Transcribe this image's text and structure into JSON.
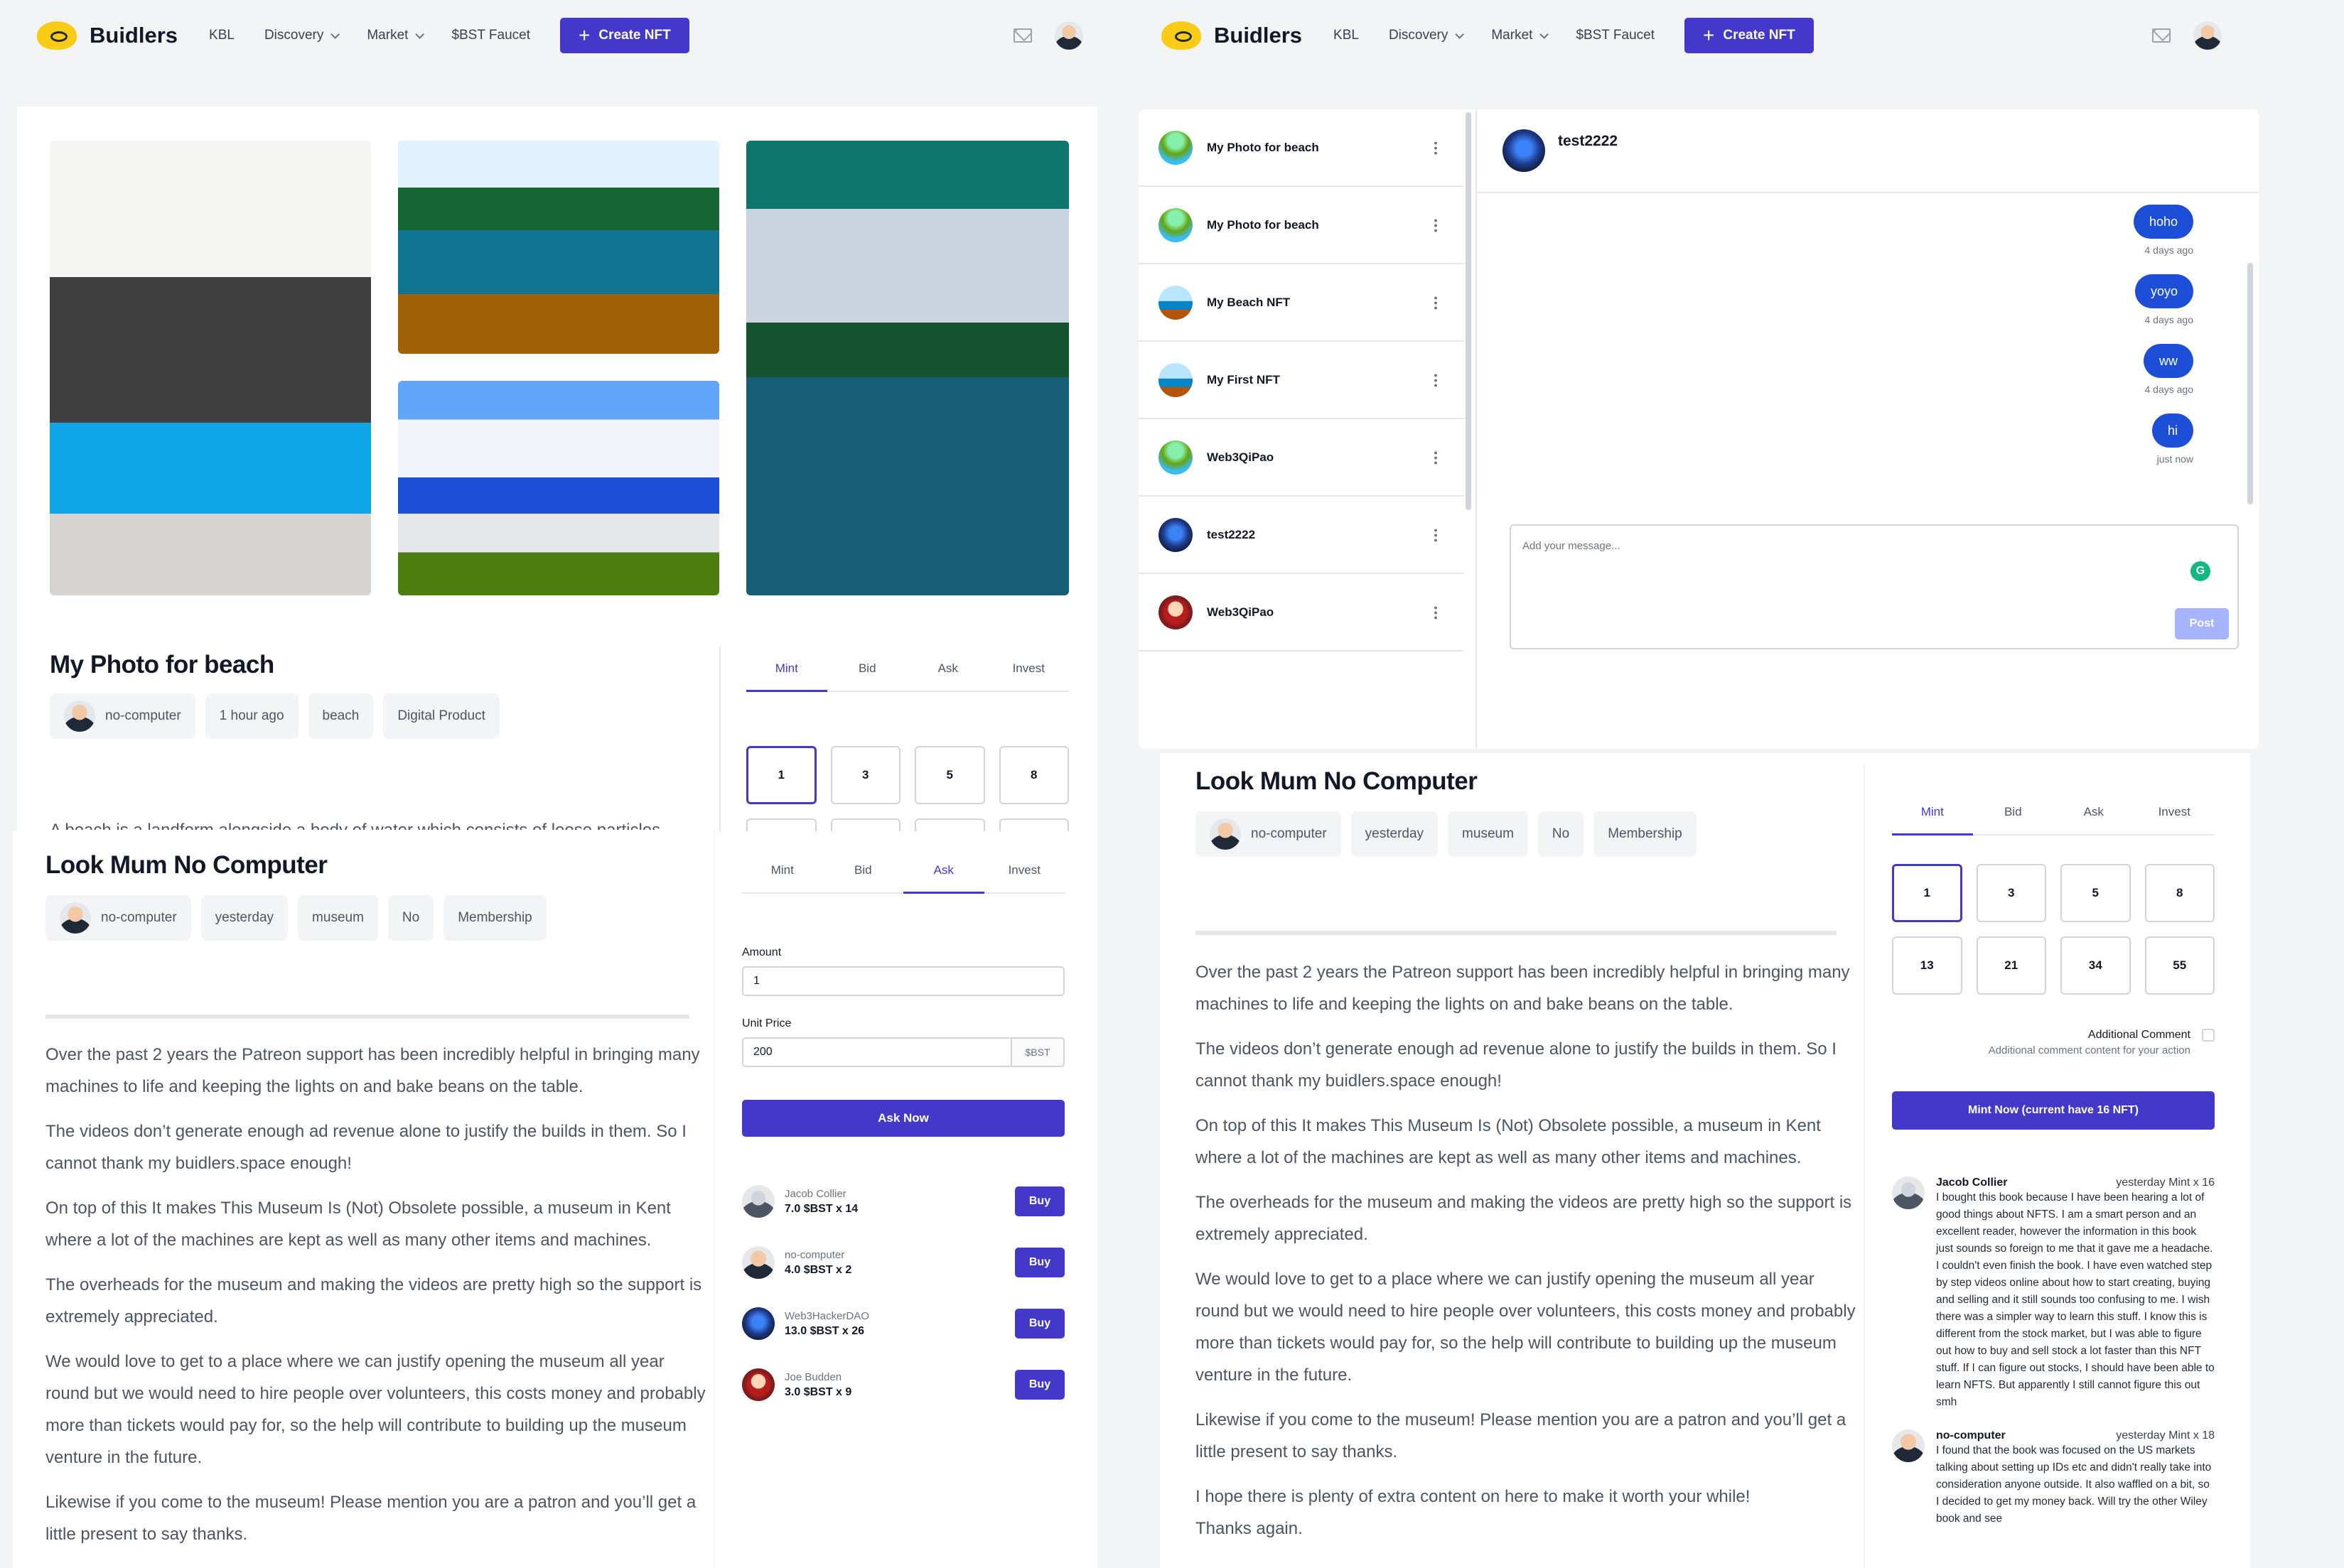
{
  "nav": {
    "brand": "Buidlers",
    "links": [
      "KBL",
      "Discovery",
      "Market",
      "$BST Faucet"
    ],
    "create_label": "Create NFT"
  },
  "beach": {
    "title": "My Photo for beach",
    "tags": [
      "no-computer",
      "1 hour ago",
      "beach",
      "Digital Product"
    ],
    "tabs": [
      "Mint",
      "Bid",
      "Ask",
      "Invest"
    ],
    "quantities": [
      "1",
      "3",
      "5",
      "8"
    ],
    "desc_partial": "A beach is a landform alongside a body of water which consists of loose particles"
  },
  "museum": {
    "title": "Look Mum No Computer",
    "tags": [
      "no-computer",
      "yesterday",
      "museum",
      "No",
      "Membership"
    ],
    "paragraphs": [
      "Over the past 2 years the Patreon support has been incredibly helpful in bringing many machines to life and keeping the lights on and bake beans on the table.",
      "The videos don’t generate enough ad revenue alone to justify the builds in them. So I cannot thank my buidlers.space enough!",
      "On top of this It makes This Museum Is (Not) Obsolete possible, a museum in Kent where a lot of the machines are kept as well as many other items and machines.",
      "The overheads for the museum and making the videos are pretty high so the support is extremely appreciated.",
      "We would love to get to a place where we can justify opening the museum all year round but we would need to hire people over volunteers, this costs money and probably more than tickets would pay for, so the help will contribute to building up the museum venture in the future.",
      "Likewise if you come to the museum! Please mention you are a patron and you’ll get a little present to say thanks.",
      "I hope there is plenty of extra content on here to make it worth your while! Thanks again."
    ]
  },
  "ask": {
    "tabs": [
      "Mint",
      "Bid",
      "Ask",
      "Invest"
    ],
    "amount_label": "Amount",
    "amount_value": "1",
    "price_label": "Unit Price",
    "price_value": "200",
    "price_unit": "$BST",
    "submit": "Ask Now",
    "bids": [
      {
        "name": "Jacob Collier",
        "value": "7.0 $BST x 14",
        "action": "Buy"
      },
      {
        "name": "no-computer",
        "value": "4.0 $BST x 2",
        "action": "Buy"
      },
      {
        "name": "Web3HackerDAO",
        "value": "13.0 $BST x 26",
        "action": "Buy"
      },
      {
        "name": "Joe Budden",
        "value": "3.0 $BST x 9",
        "action": "Buy"
      }
    ]
  },
  "chat": {
    "conversations": [
      "My Photo for beach",
      "My Photo for beach",
      "My Beach NFT",
      "My First NFT",
      "Web3QiPao",
      "test2222",
      "Web3QiPao"
    ],
    "active_user": "test2222",
    "messages": [
      {
        "text": "hoho",
        "time": "4 days ago"
      },
      {
        "text": "yoyo",
        "time": "4 days ago"
      },
      {
        "text": "ww",
        "time": "4 days ago"
      },
      {
        "text": "hi",
        "time": "just now"
      }
    ],
    "placeholder": "Add your message...",
    "post": "Post"
  },
  "mint": {
    "tabs": [
      "Mint",
      "Bid",
      "Ask",
      "Invest"
    ],
    "quantities": [
      "1",
      "3",
      "5",
      "8",
      "13",
      "21",
      "34",
      "55"
    ],
    "comment_label": "Additional Comment",
    "comment_hint": "Additional comment content for your action",
    "submit": "Mint Now (current have 16 NFT)",
    "comments": [
      {
        "name": "Jacob Collier",
        "meta": "yesterday Mint x 16",
        "text": "I bought this book because I have been hearing a lot of good things about NFTS. I am a smart person and an excellent reader, however the information in this book just sounds so foreign to me that it gave me a headache. I couldn't even finish the book. I have even watched step by step videos online about how to start creating, buying and selling and it still sounds too confusing to me. I wish there was a simpler way to learn this stuff. I know this is different from the stock market, but I was able to figure out how to buy and sell stock a lot faster than this NFT stuff. If I can figure out stocks, I should have been able to learn NFTS. But apparently I still cannot figure this out smh"
      },
      {
        "name": "no-computer",
        "meta": "yesterday Mint x 18",
        "text": "I found that the book was focused on the US markets talking about setting up IDs etc and didn't really take into consideration anyone outside. It also waffled on a bit, so I decided to get my money back. Will try the other Wiley book and see"
      }
    ]
  },
  "colors": {
    "accent": "#4338ca",
    "bubble": "#1d4ed8",
    "logo": "#facc15"
  }
}
